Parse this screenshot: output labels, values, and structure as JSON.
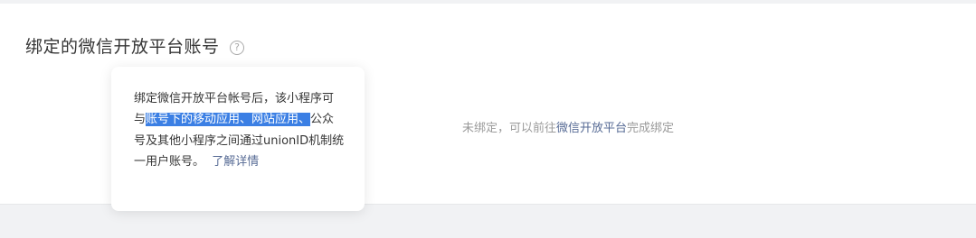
{
  "section": {
    "title": "绑定的微信开放平台账号",
    "help_icon_glyph": "?"
  },
  "status": {
    "prefix": "未绑定，可以前往",
    "link": "微信开放平台",
    "suffix": "完成绑定"
  },
  "tooltip": {
    "text_before_selection": "绑定微信开放平台帐号后，该小程序可与",
    "selected_text": "账号下的移动应用、网站应用、",
    "text_after_selection": "公众号及其他小程序之间通过unionID机制统一用户账号。",
    "learn_more": "了解详情"
  },
  "colors": {
    "link": "#576b95",
    "selection": "#3b7fe4",
    "muted_text": "#9a9a9a",
    "page_bg": "#f1f2f4"
  }
}
